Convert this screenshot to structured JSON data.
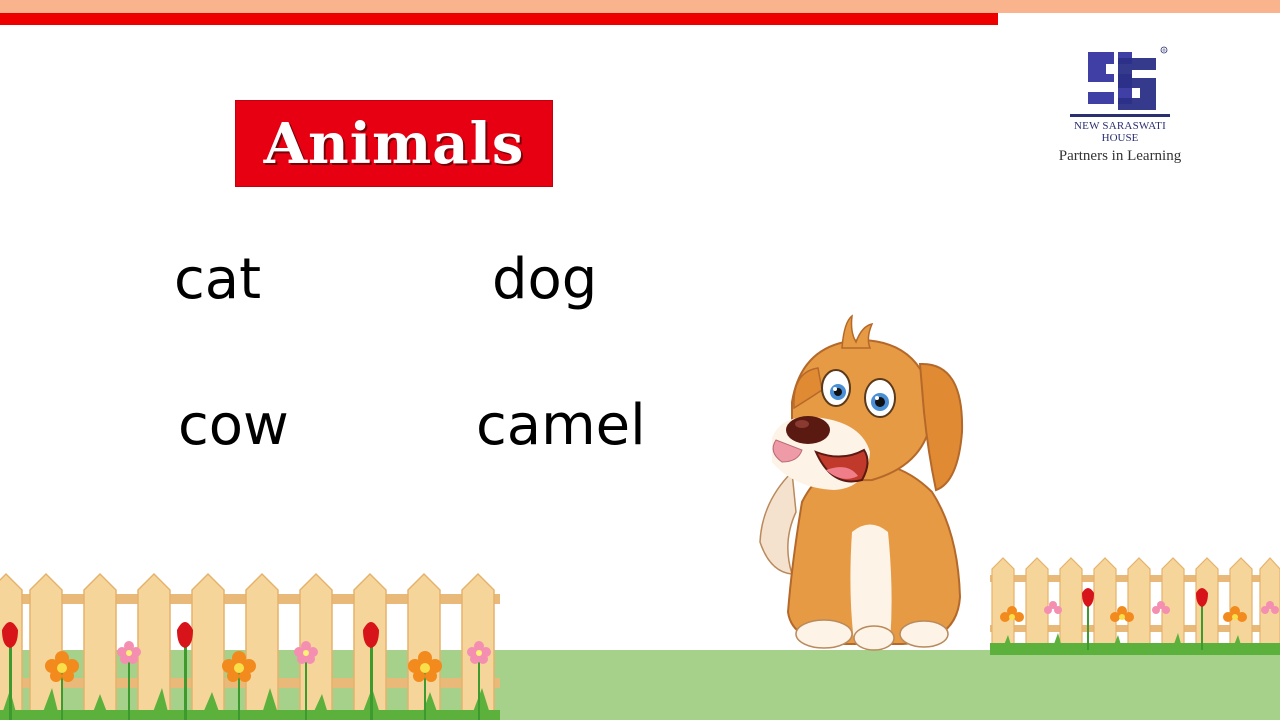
{
  "title": "Animals",
  "words": [
    "cat",
    "dog",
    "cow",
    "camel"
  ],
  "logo": {
    "line1": "NEW SARASWATI",
    "line2": "HOUSE",
    "tagline": "Partners in Learning",
    "registered": "®"
  },
  "colors": {
    "title_bg": "#e60012",
    "top_bar_red": "#ee0000",
    "top_bar_light": "#f9b48e",
    "ground": "#a6d18a",
    "fence": "#f6d59a",
    "dog_body": "#e79a44",
    "logo_blue": "#2a2f70"
  },
  "icons": {
    "logo": "nsh-logo-icon",
    "dog": "dog-illustration",
    "fence": "picket-fence-icon",
    "flower": "flower-icon",
    "tulip": "tulip-icon"
  }
}
